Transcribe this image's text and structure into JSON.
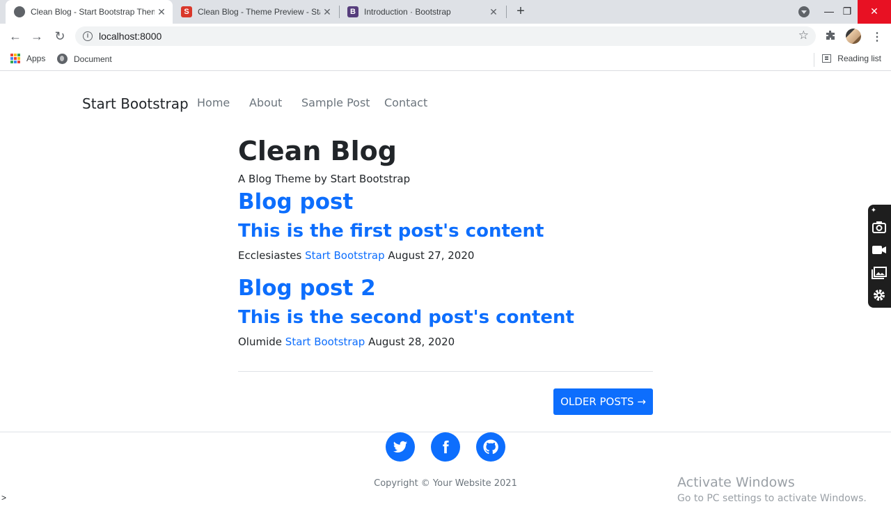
{
  "browser": {
    "tabs": [
      {
        "title": "Clean Blog - Start Bootstrap Theme",
        "active": true
      },
      {
        "title": "Clean Blog - Theme Preview - Start Bootstrap",
        "favicon_letter": "S",
        "favicon_color": "#d9372a"
      },
      {
        "title": "Introduction · Bootstrap",
        "favicon_letter": "B",
        "favicon_color": "#563d7c"
      }
    ],
    "url": "localhost:8000",
    "bookmarks": [
      {
        "label": "Apps"
      },
      {
        "label": "Document"
      }
    ],
    "reading_list": "Reading list"
  },
  "navbar": {
    "brand": "Start Bootstrap",
    "links": [
      "Home",
      "About",
      "Sample Post",
      "Contact"
    ]
  },
  "header": {
    "title": "Clean Blog",
    "subtitle": "A Blog Theme by Start Bootstrap"
  },
  "posts": [
    {
      "title": "Blog post",
      "subtitle": "This is the first post's content",
      "author_prefix": "Ecclesiastes",
      "author_link": "Start Bootstrap",
      "date": "August 27, 2020"
    },
    {
      "title": "Blog post 2",
      "subtitle": "This is the second post's content",
      "author_prefix": "Olumide",
      "author_link": "Start Bootstrap",
      "date": "August 28, 2020"
    }
  ],
  "pager": {
    "older_label": "OLDER POSTS →"
  },
  "footer": {
    "social": [
      "twitter-icon",
      "facebook-icon",
      "github-icon"
    ],
    "copyright": "Copyright © Your Website 2021"
  },
  "overlay": {
    "activate_title": "Activate Windows",
    "activate_sub": "Go to PC settings to activate Windows."
  },
  "console_caret": ">",
  "colors": {
    "accent": "#0d6efd",
    "text": "#212529",
    "muted": "#6c757d"
  }
}
